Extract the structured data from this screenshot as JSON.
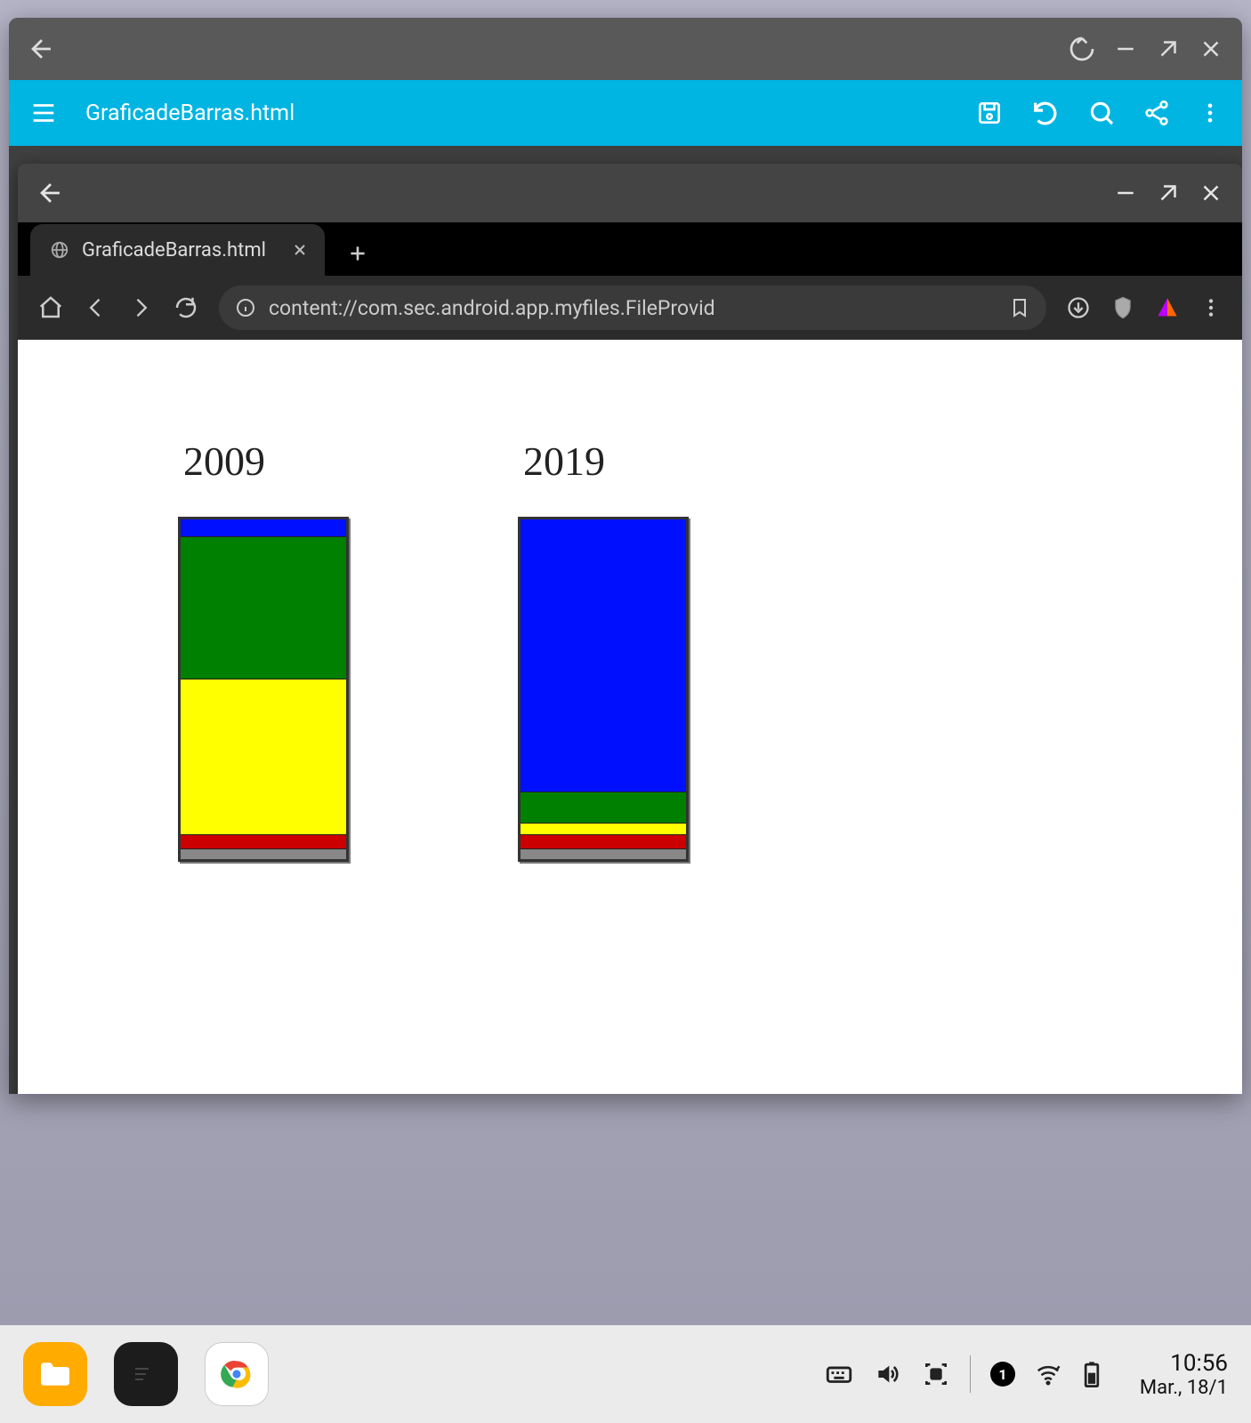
{
  "outer_window": {
    "back_icon": "arrow-left"
  },
  "app_bar": {
    "title": "GraficadeBarras.html"
  },
  "inner_window": {},
  "browser": {
    "tab_label": "GraficadeBarras.html",
    "url": "content://com.sec.android.app.myfiles.FileProvid"
  },
  "chart_data": {
    "type": "bar",
    "subtype": "stacked",
    "categories": [
      "2009",
      "2019"
    ],
    "segments": [
      "blue",
      "green",
      "yellow",
      "red",
      "gray"
    ],
    "series": [
      {
        "name": "2009",
        "values": {
          "blue": 5,
          "green": 42,
          "yellow": 46,
          "red": 4,
          "gray": 3
        }
      },
      {
        "name": "2019",
        "values": {
          "blue": 81,
          "green": 9,
          "yellow": 3,
          "red": 4,
          "gray": 3
        }
      }
    ],
    "colors": {
      "blue": "#0010ff",
      "green": "#008000",
      "yellow": "#ffff00",
      "red": "#cc0000",
      "gray": "#888888"
    }
  },
  "taskbar": {
    "badge": "1",
    "time": "10:56",
    "date": "Mar., 18/1"
  }
}
